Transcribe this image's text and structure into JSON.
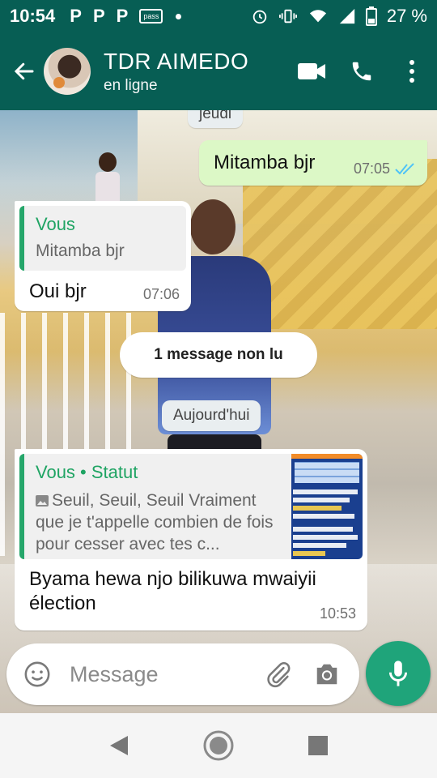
{
  "status_bar": {
    "time": "10:54",
    "notification_letters": [
      "P",
      "P",
      "P"
    ],
    "pass_label": "pass",
    "battery": "27 %"
  },
  "header": {
    "contact_name": "TDR AIMEDO",
    "presence": "en ligne",
    "icons": [
      "back-arrow-icon",
      "avatar",
      "video-call-icon",
      "phone-icon",
      "more-vert-icon"
    ]
  },
  "chat": {
    "date_top": "jeudi",
    "messages": [
      {
        "text": "Mitamba bjr",
        "time": "07:05",
        "direction": "outgoing",
        "ticks": "double-blue"
      },
      {
        "quote_author": "Vous",
        "quote_text": "Mitamba bjr",
        "text": "Oui bjr",
        "time": "07:06",
        "direction": "incoming"
      },
      {
        "quote_author": "Vous • Statut",
        "quote_text": "Seuil, Seuil, Seuil Vraiment que je t'appelle combien de fois pour cesser avec tes c...",
        "text": "Byama hewa njo bilikuwa mwaiyii élection",
        "time": "10:53",
        "direction": "incoming"
      }
    ],
    "unread_banner": "1 message non lu",
    "date_today": "Aujourd'hui"
  },
  "input": {
    "placeholder": "Message",
    "icons": [
      "emoji-icon",
      "attach-icon",
      "camera-icon",
      "mic-icon"
    ]
  },
  "colors": {
    "header": "#075E54",
    "outgoing_bubble": "#DCF8C6",
    "accent_green": "#1fa463",
    "mic_button": "#1fa47a",
    "read_ticks": "#4fc3f7"
  }
}
